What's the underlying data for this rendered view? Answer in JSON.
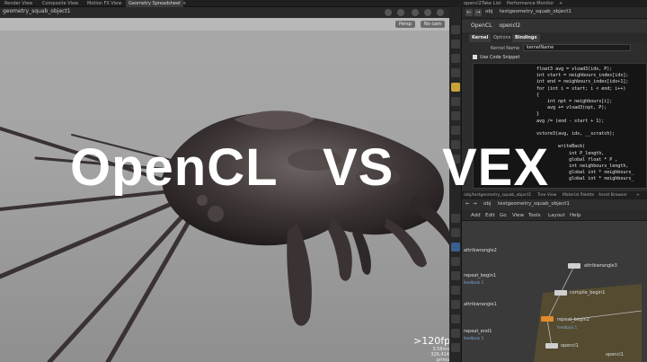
{
  "top_tabs": [
    "Render View",
    "Composite View",
    "Motion FX View",
    "Geometry Spreadsheet",
    "+"
  ],
  "viewport": {
    "path": "geometry_squab_object1",
    "persp_label": "Persp",
    "cam_label": "No cam",
    "fps": ">120fps",
    "stats": [
      "3.58ms",
      "326,414 prims"
    ]
  },
  "right_tabs": [
    "opencl2",
    "Take List",
    "Performance Monitor",
    "+"
  ],
  "param_path": {
    "obj": "obj",
    "node": "testgeometry_squab_object1"
  },
  "node_header": {
    "type": "OpenCL",
    "name": "opencl2"
  },
  "param_tabs": [
    "Kernel",
    "Options",
    "Bindings"
  ],
  "kernel_name_label": "Kernel Name",
  "kernel_name_value": "kernelName",
  "use_code_snippet": "Use Code Snippet",
  "code_lines": [
    "float3 avg = vload3(idx, P);",
    "int start = neighbours_index[idx];",
    "int end = neighbours_index[idx+1];",
    "for (int i = start; i < end; i++)",
    "{",
    "    int npt = neighbours[i];",
    "    avg += vload3(npt, P);",
    "}",
    "avg /= (end - start + 1);",
    "",
    "vstore3(avg, idx, __scratch);",
    "",
    "        writeBack(",
    "            int P_length,",
    "            global float * P ,",
    "            int neighbours_length,",
    "            global int * neighbours_",
    "            global int * neighbours_"
  ],
  "net_tabs": [
    "/obj/testgeometry_squab_object1",
    "Tree View",
    "Material Palette",
    "Asset Browser",
    "+"
  ],
  "net_path": {
    "obj": "obj",
    "node": "testgeometry_squab_object1"
  },
  "net_menu": [
    "Add",
    "Edit",
    "Go",
    "View",
    "Tools",
    "Layout",
    "Help"
  ],
  "net_nodes": {
    "n1": "attribwrangle2",
    "n2": "repeat_begin1",
    "n2_sub": "feedback 1",
    "n3": "attribwrangle1",
    "n4": "repeat_end1",
    "n4_sub": "feedback 5",
    "n5": "attribwrangle3",
    "n6": "compile_begin1",
    "n7": "repeat_begin2",
    "n7_sub": "feedback 1",
    "n8": "opencl1",
    "n9": "opencl1"
  },
  "overlay_title": [
    "OpenCL",
    "VS",
    "VEX"
  ]
}
